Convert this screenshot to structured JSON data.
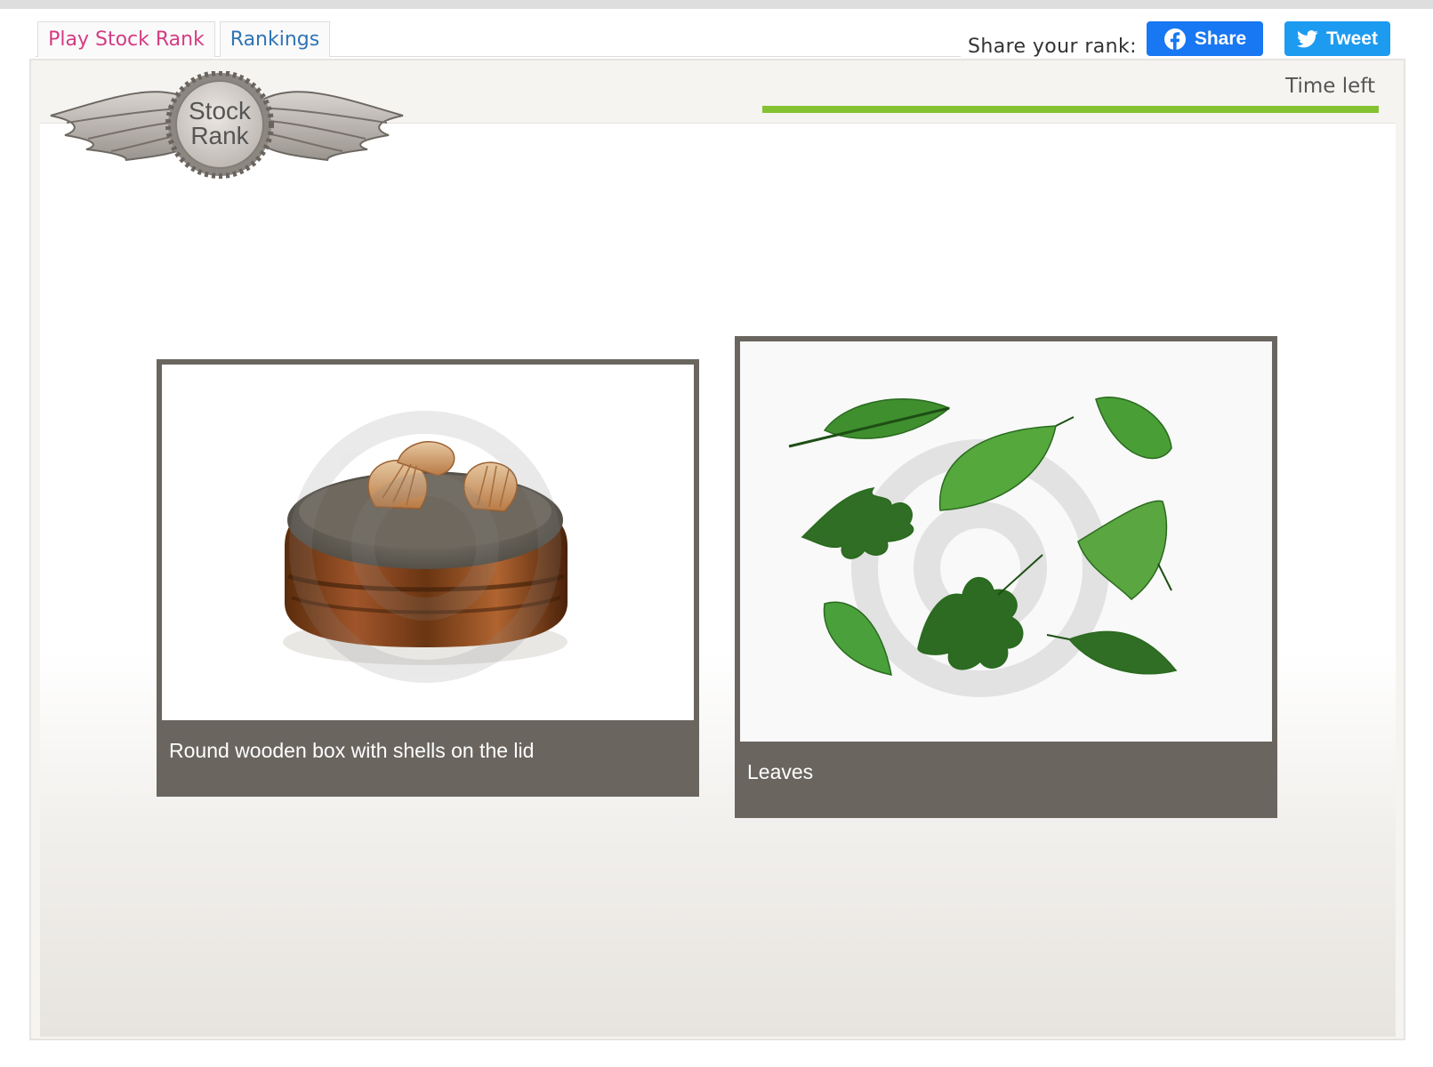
{
  "nav": {
    "tabs": [
      {
        "label": "Play Stock Rank",
        "color": "#d43c82"
      },
      {
        "label": "Rankings",
        "color": "#2f74b5"
      }
    ]
  },
  "share": {
    "label": "Share your rank:",
    "facebook_label": "Share",
    "twitter_label": "Tweet",
    "facebook_color": "#1877f2",
    "twitter_color": "#1d9bf0"
  },
  "logo": {
    "line1": "Stock",
    "line2": "Rank"
  },
  "timer": {
    "label": "Time left",
    "bar_color": "#85c232",
    "remaining_fraction": 1.0
  },
  "cards": [
    {
      "caption": "Round wooden box with shells on the lid",
      "subject": "round wooden box with seashells on lid"
    },
    {
      "caption": "Leaves",
      "subject": "assorted green leaves"
    }
  ],
  "icons": {
    "facebook": "facebook-icon",
    "twitter": "twitter-bird-icon",
    "logo": "winged-badge-logo"
  }
}
